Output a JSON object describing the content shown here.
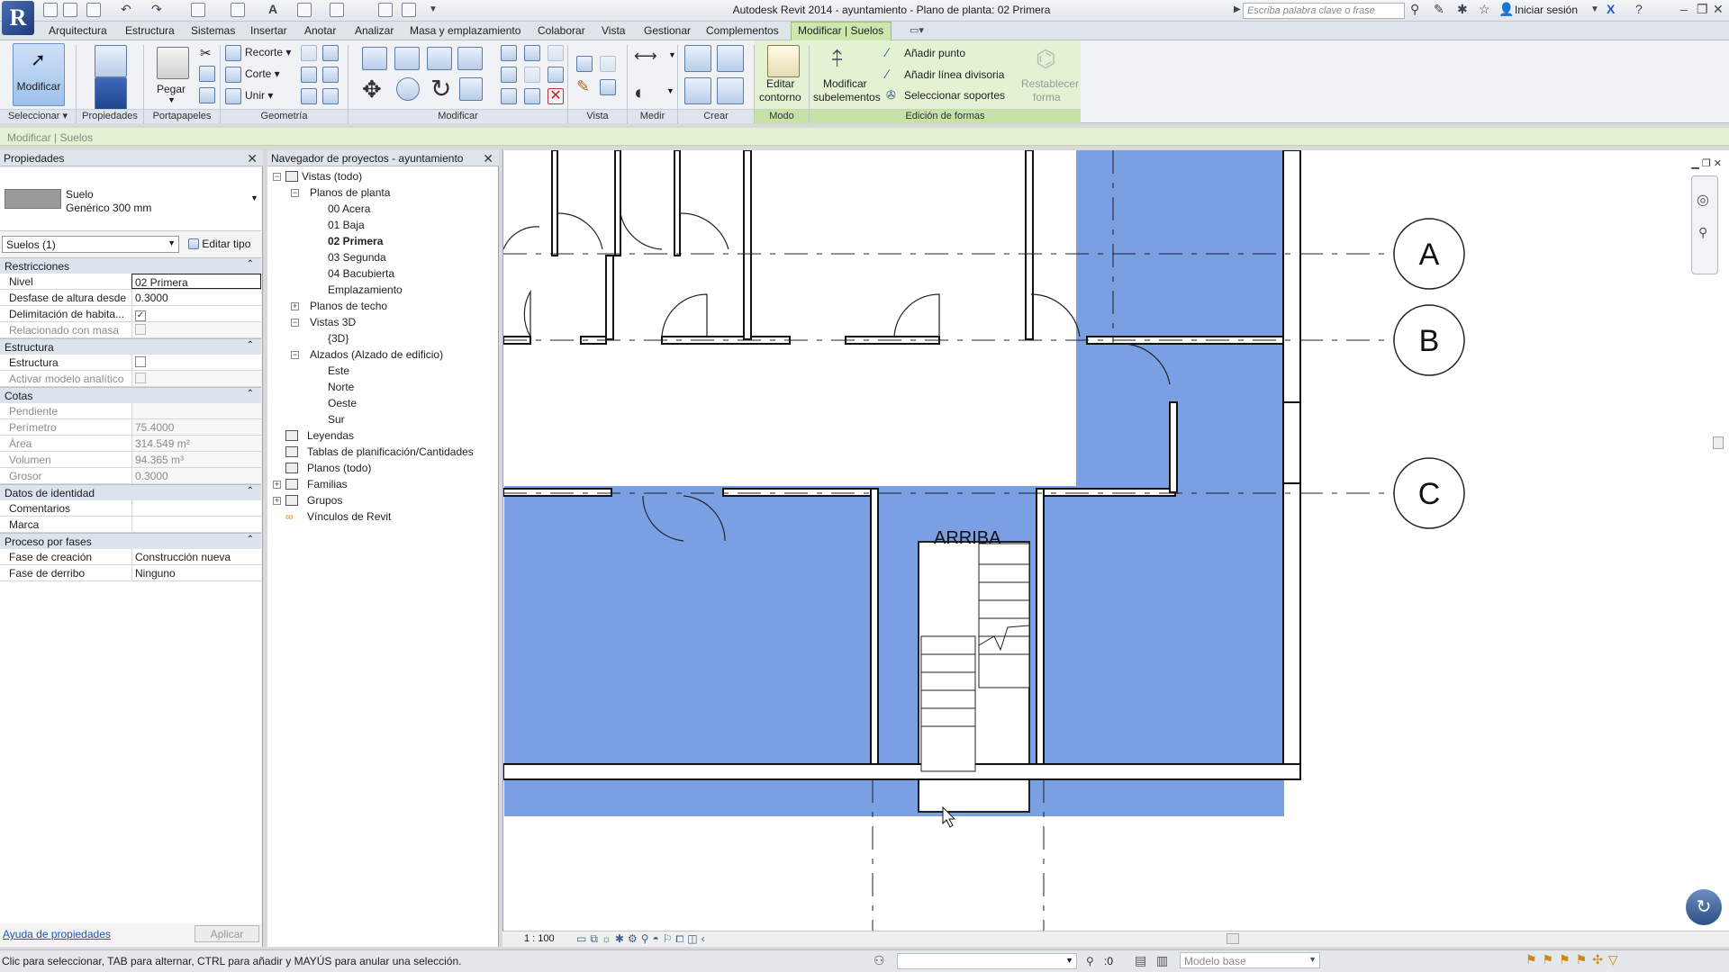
{
  "app": {
    "title": "Autodesk Revit 2014 -     ayuntamiento - Plano de planta: 02 Primera",
    "logo_letter": "R",
    "search_placeholder": "Escriba palabra clave o frase",
    "signin_label": "Iniciar sesión"
  },
  "menu_tabs": [
    "Arquitectura",
    "Estructura",
    "Sistemas",
    "Insertar",
    "Anotar",
    "Analizar",
    "Masa y emplazamiento",
    "Colaborar",
    "Vista",
    "Gestionar",
    "Complementos",
    "Modificar | Suelos"
  ],
  "ribbon": {
    "modificar_label": "Modificar",
    "pegar_label": "Pegar",
    "recorte_label": "Recorte",
    "corte_label": "Corte",
    "unir_label": "Unir",
    "editar_contorno": [
      "Editar",
      "contorno"
    ],
    "modificar_subelementos": [
      "Modificar",
      "subelementos"
    ],
    "anadir_punto": "Añadir punto",
    "anadir_linea": "Añadir línea divisoria",
    "seleccionar_soportes": "Seleccionar soportes",
    "restablecer_forma": [
      "Restablecer",
      "forma"
    ],
    "panels": {
      "seleccionar": "Seleccionar",
      "propiedades": "Propiedades",
      "portapapeles": "Portapapeles",
      "geometria": "Geometría",
      "modificar": "Modificar",
      "vista": "Vista",
      "medir": "Medir",
      "crear": "Crear",
      "modo": "Modo",
      "edicion": "Edición de formas"
    }
  },
  "options_bar": "Modificar | Suelos",
  "properties": {
    "title": "Propiedades",
    "type_name": "Suelo",
    "type_sub": "Genérico 300 mm",
    "instance_selector": "Suelos (1)",
    "edit_type": "Editar tipo",
    "groups": {
      "restricciones": "Restricciones",
      "estructura": "Estructura",
      "cotas": "Cotas",
      "identidad": "Datos de identidad",
      "fases": "Proceso por fases"
    },
    "rows": {
      "nivel": {
        "label": "Nivel",
        "value": "02 Primera"
      },
      "desfase": {
        "label": "Desfase de altura desde...",
        "value": "0.3000"
      },
      "delimitacion": {
        "label": "Delimitación de habita..."
      },
      "relacionado": {
        "label": "Relacionado con masa"
      },
      "estructura": {
        "label": "Estructura"
      },
      "analitico": {
        "label": "Activar modelo analítico"
      },
      "pendiente": {
        "label": "Pendiente",
        "value": ""
      },
      "perimetro": {
        "label": "Perímetro",
        "value": "75.4000"
      },
      "area": {
        "label": "Área",
        "value": "314.549 m²"
      },
      "volumen": {
        "label": "Volumen",
        "value": "94.365 m³"
      },
      "grosor": {
        "label": "Grosor",
        "value": "0.3000"
      },
      "comentarios": {
        "label": "Comentarios",
        "value": ""
      },
      "marca": {
        "label": "Marca",
        "value": ""
      },
      "fase_creacion": {
        "label": "Fase de creación",
        "value": "Construcción nueva"
      },
      "fase_derribo": {
        "label": "Fase de derribo",
        "value": "Ninguno"
      }
    },
    "help_link": "Ayuda de propiedades",
    "apply_button": "Aplicar"
  },
  "browser": {
    "title": "Navegador de proyectos - ayuntamiento",
    "nodes": {
      "vistas": "Vistas (todo)",
      "planos_planta": "Planos de planta",
      "acera": "00 Acera",
      "baja": "01 Baja",
      "primera": "02 Primera",
      "segunda": "03 Segunda",
      "bacubierta": "04 Bacubierta",
      "emplazamiento": "Emplazamiento",
      "planos_techo": "Planos de techo",
      "vistas3d": "Vistas 3D",
      "v3d": "{3D}",
      "alzados": "Alzados (Alzado de edificio)",
      "este": "Este",
      "norte": "Norte",
      "oeste": "Oeste",
      "sur": "Sur",
      "leyendas": "Leyendas",
      "tablas": "Tablas de planificación/Cantidades",
      "planos": "Planos (todo)",
      "familias": "Familias",
      "grupos": "Grupos",
      "vinculos": "Vínculos de Revit"
    }
  },
  "drawing": {
    "grid_labels": [
      "A",
      "B",
      "C"
    ],
    "stair_label": "ARRIBA",
    "floor_color": "#7b9fe3"
  },
  "view_bar": {
    "scale": "1 : 100"
  },
  "status": {
    "text": "Clic para seleccionar, TAB para alternar, CTRL para añadir y MAYÚS para anular una selección.",
    "count": ":0",
    "model": "Modelo base"
  }
}
